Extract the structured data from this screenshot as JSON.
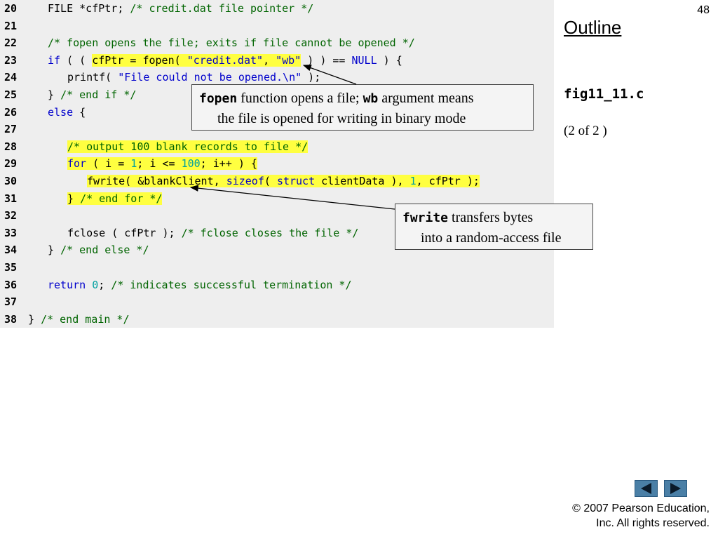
{
  "slide_number": "48",
  "outline_title": "Outline",
  "file_name": "fig11_11.c",
  "page_of": "(2 of 2 )",
  "code_lines": [
    {
      "n": "20",
      "indent": 1,
      "segments": [
        {
          "t": "FILE *cfPtr; "
        },
        {
          "t": "/* credit.dat file pointer */",
          "c": "cm"
        }
      ]
    },
    {
      "n": "21",
      "indent": 0,
      "segments": []
    },
    {
      "n": "22",
      "indent": 1,
      "segments": [
        {
          "t": "/* fopen opens the file; exits if file cannot be opened */",
          "c": "cm"
        }
      ]
    },
    {
      "n": "23",
      "indent": 1,
      "segments": [
        {
          "t": "if",
          "c": "kw"
        },
        {
          "t": " ( ( "
        },
        {
          "t": "cfPtr = fopen( ",
          "h": true
        },
        {
          "t": "\"credit.dat\"",
          "c": "st",
          "h": true
        },
        {
          "t": ", ",
          "h": true
        },
        {
          "t": "\"wb\"",
          "c": "st",
          "h": true
        },
        {
          "t": " ) ) == "
        },
        {
          "t": "NULL",
          "c": "kw"
        },
        {
          "t": " ) {"
        }
      ]
    },
    {
      "n": "24",
      "indent": 2,
      "segments": [
        {
          "t": "printf( "
        },
        {
          "t": "\"File could not be opened.\\n\"",
          "c": "st"
        },
        {
          "t": " );"
        }
      ]
    },
    {
      "n": "25",
      "indent": 1,
      "segments": [
        {
          "t": "} "
        },
        {
          "t": "/* end if */",
          "c": "cm"
        }
      ]
    },
    {
      "n": "26",
      "indent": 1,
      "segments": [
        {
          "t": "else",
          "c": "kw"
        },
        {
          "t": " {"
        }
      ]
    },
    {
      "n": "27",
      "indent": 0,
      "segments": []
    },
    {
      "n": "28",
      "indent": 2,
      "segments": [
        {
          "t": "/* output 100 blank records to file */",
          "c": "cm",
          "h": true
        }
      ]
    },
    {
      "n": "29",
      "indent": 2,
      "segments": [
        {
          "t": "for",
          "c": "kw",
          "h": true
        },
        {
          "t": " ( i = ",
          "h": true
        },
        {
          "t": "1",
          "c": "nm",
          "h": true
        },
        {
          "t": "; i <= ",
          "h": true
        },
        {
          "t": "100",
          "c": "nm",
          "h": true
        },
        {
          "t": "; i++ ) {",
          "h": true
        }
      ]
    },
    {
      "n": "30",
      "indent": 3,
      "segments": [
        {
          "t": "fwrite( &blankClient, ",
          "h": true
        },
        {
          "t": "sizeof",
          "c": "kw",
          "h": true
        },
        {
          "t": "( ",
          "h": true
        },
        {
          "t": "struct",
          "c": "kw",
          "h": true
        },
        {
          "t": " clientData ), ",
          "h": true
        },
        {
          "t": "1",
          "c": "nm",
          "h": true
        },
        {
          "t": ", cfPtr );",
          "h": true
        }
      ]
    },
    {
      "n": "31",
      "indent": 2,
      "segments": [
        {
          "t": "} ",
          "h": true
        },
        {
          "t": "/* end for */",
          "c": "cm",
          "h": true
        }
      ]
    },
    {
      "n": "32",
      "indent": 0,
      "segments": []
    },
    {
      "n": "33",
      "indent": 2,
      "segments": [
        {
          "t": "fclose ( cfPtr ); "
        },
        {
          "t": "/* fclose closes the file */",
          "c": "cm"
        }
      ]
    },
    {
      "n": "34",
      "indent": 1,
      "segments": [
        {
          "t": "} "
        },
        {
          "t": "/* end else */",
          "c": "cm"
        }
      ]
    },
    {
      "n": "35",
      "indent": 0,
      "segments": []
    },
    {
      "n": "36",
      "indent": 1,
      "segments": [
        {
          "t": "return",
          "c": "kw"
        },
        {
          "t": " "
        },
        {
          "t": "0",
          "c": "nm"
        },
        {
          "t": "; "
        },
        {
          "t": "/* indicates successful termination */",
          "c": "cm"
        }
      ]
    },
    {
      "n": "37",
      "indent": 0,
      "segments": []
    },
    {
      "n": "38",
      "indent": 0,
      "segments": [
        {
          "t": "} "
        },
        {
          "t": "/* end main */",
          "c": "cm"
        }
      ]
    }
  ],
  "callout_fopen": {
    "code1": "fopen",
    "text1": " function opens a file; ",
    "code2": "wb",
    "text2": " argument means",
    "line2": "the file is opened for writing in binary mode"
  },
  "callout_fwrite": {
    "code1": "fwrite",
    "text1": " transfers bytes",
    "line2": "into a random-access file"
  },
  "copyright": {
    "line1": "© 2007 Pearson Education,",
    "line2": "Inc.  All rights reserved."
  },
  "colors": {
    "keyword": "#0000cc",
    "comment": "#006400",
    "number": "#00a0a0",
    "highlight": "#ffff40",
    "nav_button": "#4a7fa6"
  },
  "icons": {
    "prev": "triangle-left-icon",
    "next": "triangle-right-icon"
  }
}
